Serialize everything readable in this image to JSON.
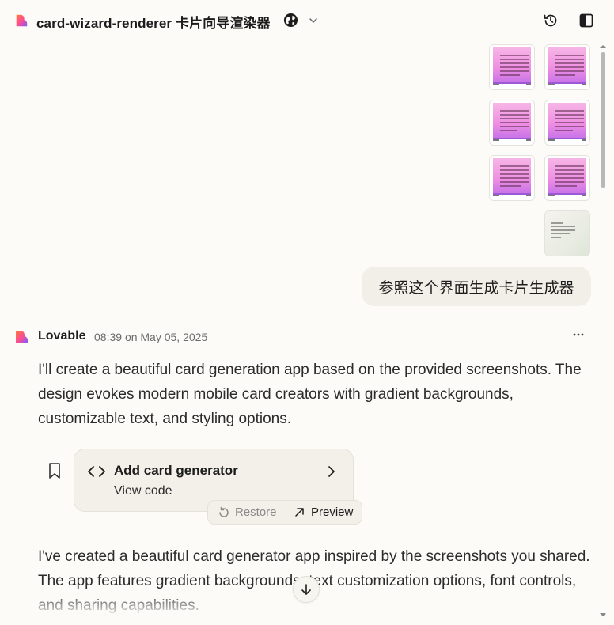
{
  "header": {
    "project_title": "card-wizard-renderer 卡片向导渲染器",
    "icons": [
      "lovable-logo-icon",
      "globe-icon",
      "chevron-down-icon",
      "history-icon",
      "sidebar-toggle-icon"
    ]
  },
  "user_message": {
    "attachments_count": 7,
    "text": "参照这个界面生成卡片生成器"
  },
  "assistant": {
    "name": "Lovable",
    "time": "08:39",
    "date_text": "on May 05, 2025",
    "paragraph_1": "I'll create a beautiful card generation app based on the provided screenshots. The design evokes modern mobile card creators with gradient backgrounds, customizable text, and styling options.",
    "card": {
      "title": "Add card generator",
      "subtitle": "View code"
    },
    "actions": {
      "restore": "Restore",
      "preview": "Preview"
    },
    "paragraph_2": "I've created a beautiful card generator app inspired by the screenshots you shared. The app features gradient backgrounds, text customization options, font controls, and sharing capabilities."
  },
  "colors": {
    "background": "#fcfbf8",
    "bubble": "#f2efe8",
    "card": "#f3f0ea",
    "brand_gradient": [
      "#ff4d8d",
      "#ff7a3d",
      "#7b5cff"
    ]
  }
}
